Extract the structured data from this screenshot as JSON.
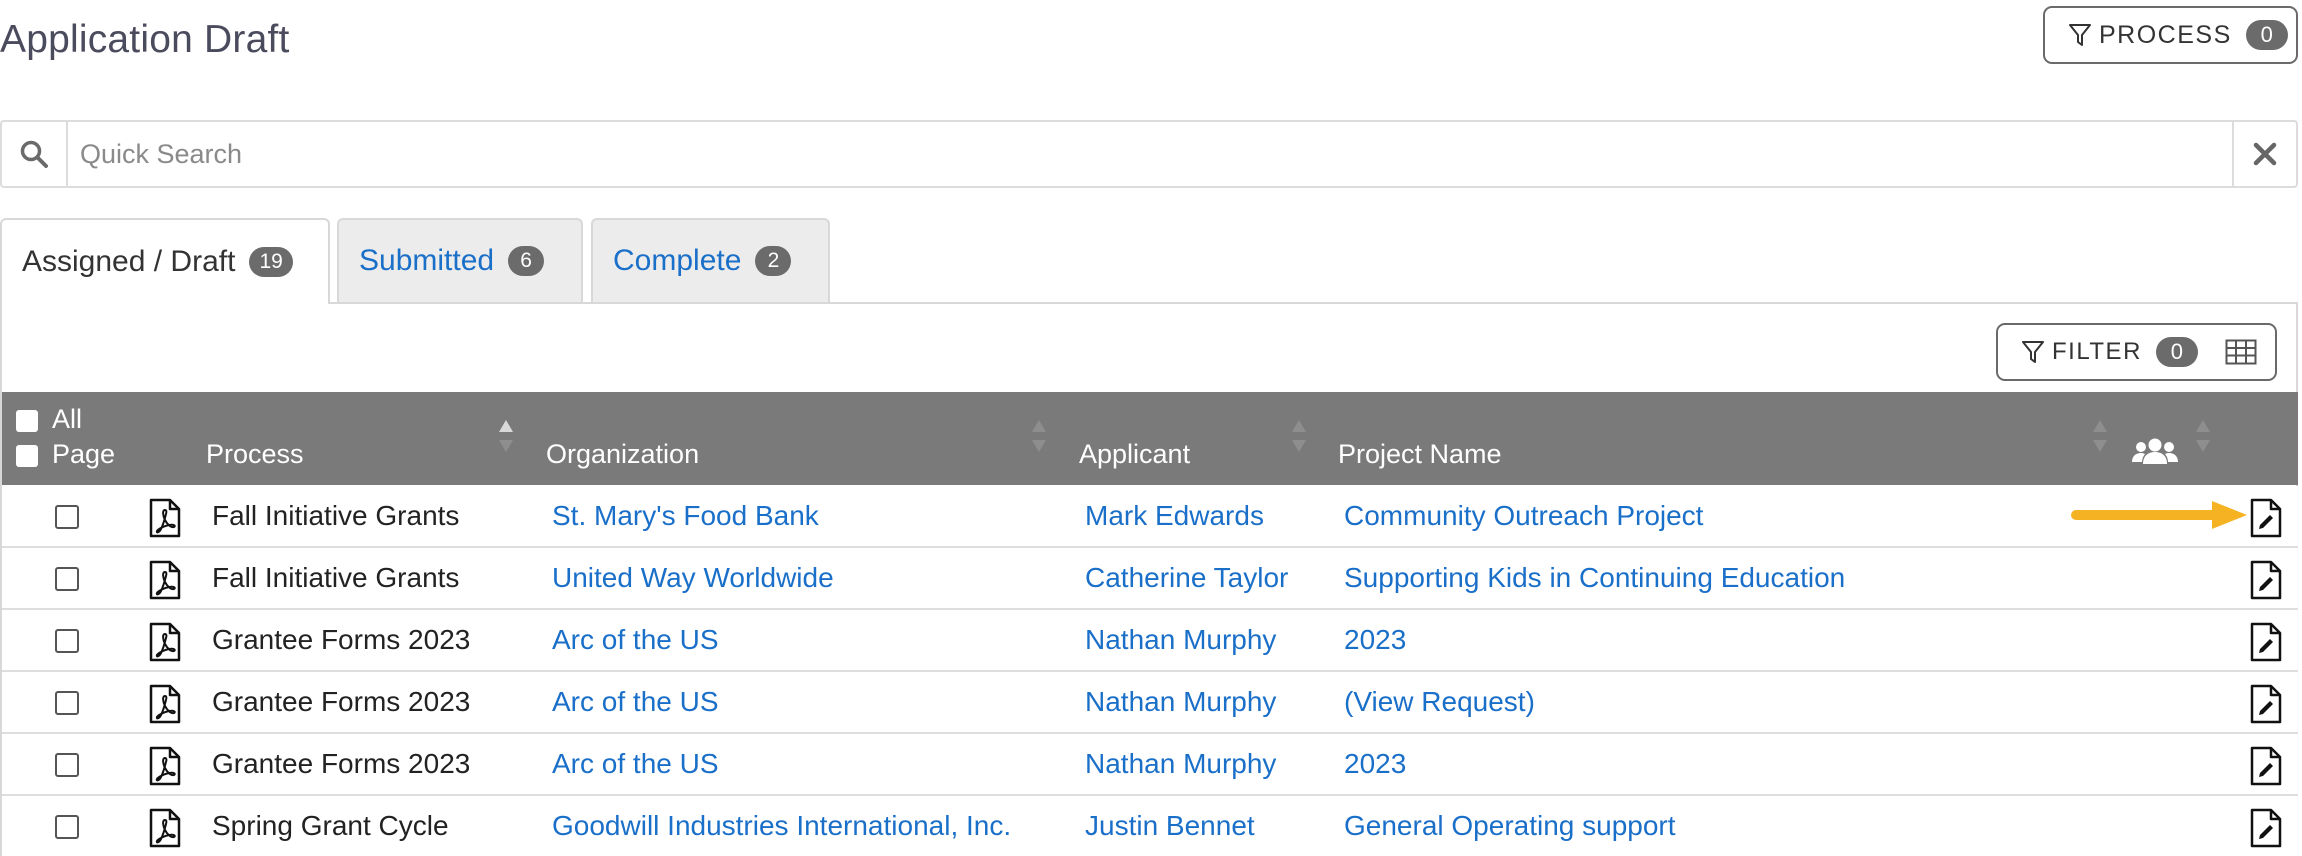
{
  "page": {
    "title": "Application Draft"
  },
  "process_button": {
    "label": "PROCESS",
    "count": "0",
    "icon": "funnel-icon"
  },
  "search": {
    "placeholder": "Quick Search",
    "value": "",
    "icon": "search-icon",
    "clear_icon": "close-icon"
  },
  "tabs": [
    {
      "label": "Assigned / Draft",
      "count": "19",
      "active": true
    },
    {
      "label": "Submitted",
      "count": "6",
      "active": false
    },
    {
      "label": "Complete",
      "count": "2",
      "active": false
    }
  ],
  "filter_button": {
    "label": "FILTER",
    "count": "0",
    "icon": "funnel-icon",
    "grid_icon": "table-grid-icon"
  },
  "table": {
    "select_all": {
      "all_label": "All",
      "page_label": "Page"
    },
    "columns": {
      "process": "Process",
      "organization": "Organization",
      "applicant": "Applicant",
      "project": "Project Name",
      "team_icon": "users-icon"
    },
    "rows": [
      {
        "process": "Fall Initiative Grants",
        "organization": "St. Mary's Food Bank",
        "applicant": "Mark Edwards",
        "project": "Community Outreach Project"
      },
      {
        "process": "Fall Initiative Grants",
        "organization": "United Way Worldwide",
        "applicant": "Catherine Taylor",
        "project": "Supporting Kids in Continuing Education"
      },
      {
        "process": "Grantee Forms 2023",
        "organization": "Arc of the US",
        "applicant": "Nathan Murphy",
        "project": "2023"
      },
      {
        "process": "Grantee Forms 2023",
        "organization": "Arc of the US",
        "applicant": "Nathan Murphy",
        "project": "(View Request)"
      },
      {
        "process": "Grantee Forms 2023",
        "organization": "Arc of the US",
        "applicant": "Nathan Murphy",
        "project": "2023"
      },
      {
        "process": "Spring Grant Cycle",
        "organization": "Goodwill Industries International, Inc.",
        "applicant": "Justin Bennet",
        "project": "General Operating support"
      }
    ]
  },
  "colors": {
    "link": "#1a6fc9",
    "header_bg": "#7a7a7a",
    "badge_bg": "#6b6b6b",
    "annotation_arrow": "#f5b324"
  }
}
